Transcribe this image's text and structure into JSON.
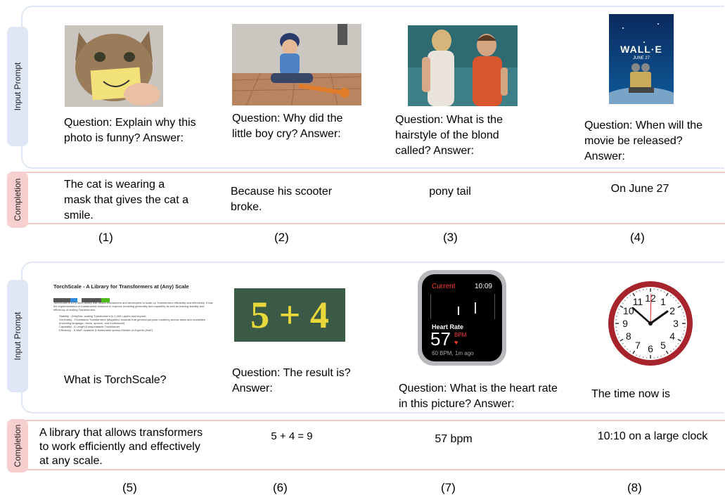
{
  "labels": {
    "input_prompt": "Input Prompt",
    "completion": "Completion"
  },
  "rows": [
    {
      "items": [
        {
          "question": "Question: Explain why this photo is funny? Answer:",
          "completion": "The cat is wearing a mask that gives the cat a smile.",
          "number": "(1)"
        },
        {
          "question": "Question: Why did the little boy cry? Answer:",
          "completion": "Because his scooter broke.",
          "number": "(2)"
        },
        {
          "question": "Question: What is the hairstyle of the blond called? Answer:",
          "completion": "pony tail",
          "number": "(3)"
        },
        {
          "question": "Question: When will the movie be released? Answer:",
          "completion": "On June 27",
          "number": "(4)"
        }
      ]
    },
    {
      "items": [
        {
          "question": "What is TorchScale?",
          "completion": "A library that allows transformers to work efficiently and effectively at any scale.",
          "number": "(5)"
        },
        {
          "question": "Question: The result is? Answer:",
          "completion": "5 + 4 = 9",
          "number": "(6)"
        },
        {
          "question": "Question: What is the heart rate in this picture? Answer:",
          "completion": "57 bpm",
          "number": "(7)"
        },
        {
          "question": "The time now is",
          "completion": "10:10 on a large clock",
          "number": "(8)"
        }
      ]
    }
  ],
  "images": {
    "walle_title": "WALL·E",
    "walle_date": "JUNE 27",
    "torchscale": {
      "title": "TorchScale - A Library for Transformers at (Any) Scale",
      "intro": "TorchScale is a PyTorch library that allows researchers and developers to scale up Transformers efficiently and effectively. It has the implementation of fundamental research to improve modeling generality and capability as well as training stability and efficiency of scaling Transformers.",
      "bullets": [
        "Stability - DeepNet: scaling Transformers to 1,000 Layers and beyond",
        "Generality - Foundation Transformers (Magneto): towards true general-purpose modeling across tasks and modalities (including language, vision, speech, and multimodal)",
        "Capability - A Length-Extrapolatable Transformer",
        "Efficiency - X-MoE: scalable & finetunable sparse Mixture-of-Experts (MoE)"
      ]
    },
    "math": "5 + 4",
    "watch": {
      "back": "Current",
      "time": "10:09",
      "label": "Heart Rate",
      "value": "57",
      "unit": "BPM",
      "sub": "60 BPM, 1m ago"
    },
    "clock_numbers": [
      "12",
      "1",
      "2",
      "3",
      "4",
      "5",
      "6",
      "7",
      "8",
      "9",
      "10",
      "11"
    ]
  }
}
